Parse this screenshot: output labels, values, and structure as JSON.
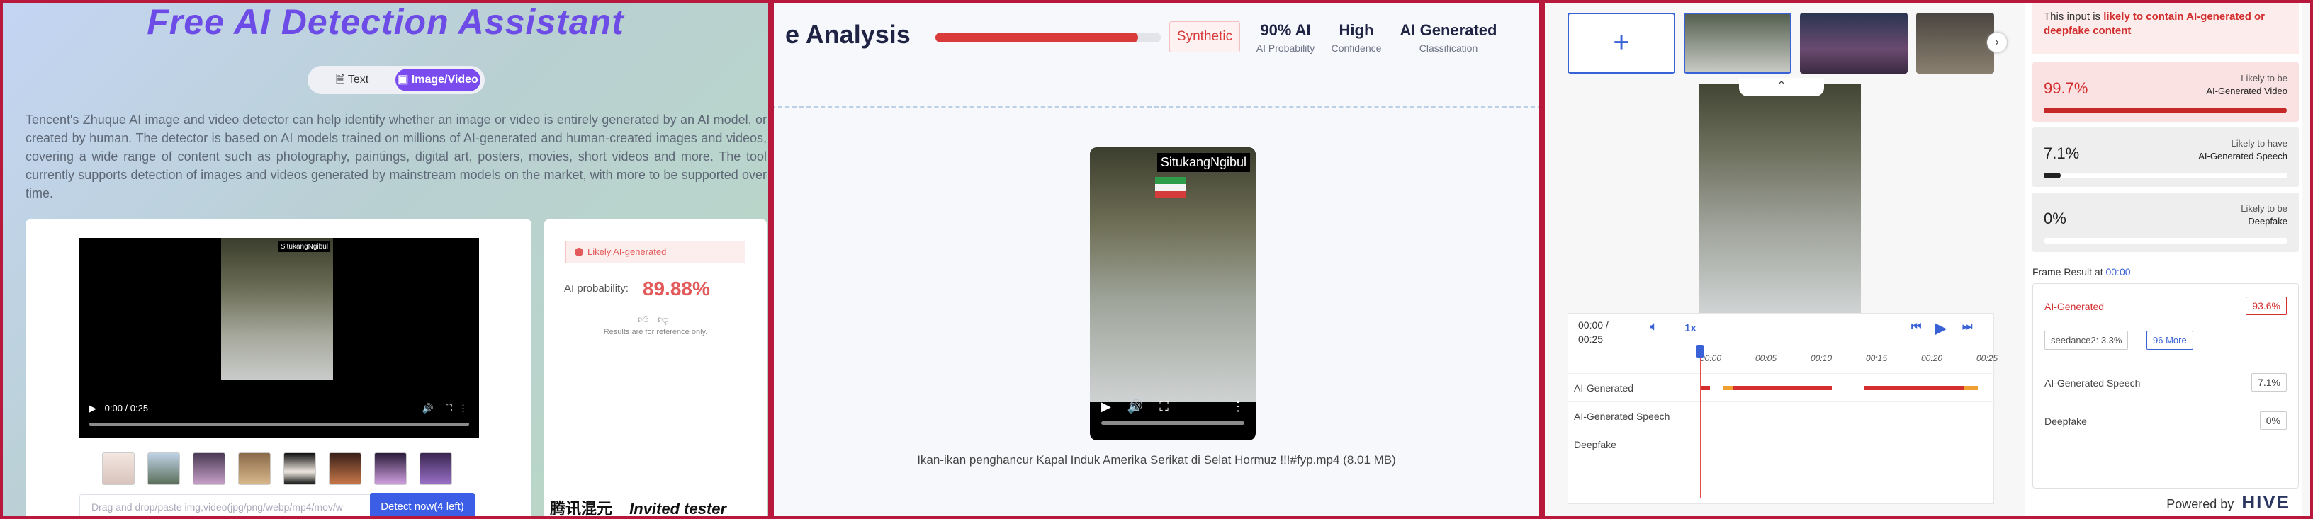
{
  "panel1": {
    "title": "Free AI Detection Assistant",
    "tabs": [
      {
        "label": "Text"
      },
      {
        "label": "Image/Video"
      }
    ],
    "description": "Tencent's Zhuque AI image and video detector can help identify whether an image or video is entirely generated by an AI model, or created by human. The detector is based on AI models trained on millions of AI-generated and human-created images and videos, covering a wide range of content such as photography, paintings, digital art, posters, movies, short videos and more. The tool currently supports detection of images and videos generated by mainstream models on the market, with more to be supported over time.",
    "video": {
      "overlay": "SitukangNgibul",
      "time": "0:00 / 0:25"
    },
    "upload_placeholder": "Drag and drop/paste img,video(jpg/png/webp/mp4/mov/w",
    "detect_label": "Detect now(4 left)",
    "result": {
      "likely": "Likely AI-generated",
      "prob_label": "AI probability:",
      "prob_value": "89.88%",
      "reference": "Results are for reference only."
    },
    "footer": {
      "brand": "腾讯混元",
      "tester": "Invited tester"
    }
  },
  "panel2": {
    "title": "e Analysis",
    "progress": 0.9,
    "badge": "Synthetic",
    "stats": [
      {
        "value": "90% AI",
        "label": "AI Probability"
      },
      {
        "value": "High",
        "label": "Confidence"
      },
      {
        "value": "AI Generated",
        "label": "Classification"
      }
    ],
    "overlay": "SitukangNgibul",
    "filename": "Ikan-ikan penghancur Kapal Induk Amerika Serikat di Selat Hormuz !!!#fyp.mp4 (8.01 MB)"
  },
  "panel3": {
    "time_current": "00:00 /",
    "time_total": "00:25",
    "speed": "1x",
    "ticks": [
      "00:00",
      "00:05",
      "00:10",
      "00:15",
      "00:20",
      "00:25"
    ],
    "tracks": [
      "AI-Generated",
      "AI-Generated Speech",
      "Deepfake"
    ],
    "alert_prefix": "This input is ",
    "alert_bold": "likely to contain AI-generated or deepfake content",
    "classes": [
      {
        "pct": "99.7%",
        "line1": "Likely to be",
        "line2": "AI-Generated Video",
        "value": 0.997
      },
      {
        "pct": "7.1%",
        "line1": "Likely to have",
        "line2": "AI-Generated Speech",
        "value": 0.071
      },
      {
        "pct": "0%",
        "line1": "Likely to be",
        "line2": "Deepfake",
        "value": 0
      }
    ],
    "frame_result_label": "Frame Result at",
    "frame_result_time": "00:00",
    "frame": {
      "ai_label": "AI-Generated",
      "ai_value": "93.6%",
      "chip1": "seedance2: 3.3%",
      "chip2": "96 More",
      "speech_label": "AI-Generated Speech",
      "speech_value": "7.1%",
      "deepfake_label": "Deepfake",
      "deepfake_value": "0%"
    },
    "powered": "Powered by",
    "hive": "HIVE",
    "colors": {
      "accent": "#3a62d7",
      "danger": "#d32f2f"
    }
  }
}
